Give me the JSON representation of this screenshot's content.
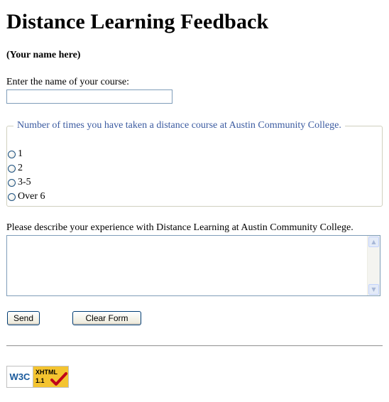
{
  "page": {
    "title": "Distance Learning Feedback",
    "subtitle": "(Your name here)"
  },
  "course": {
    "label": "Enter the name of your course:",
    "value": ""
  },
  "times": {
    "legend": "Number of times you have taken a distance course at Austin Community College.",
    "options": [
      "1",
      "2",
      "3-5",
      "Over 6"
    ]
  },
  "experience": {
    "label": "Please describe your experience with Distance Learning at Austin Community College."
  },
  "buttons": {
    "send": "Send",
    "clear": "Clear Form"
  },
  "badge": {
    "w3c": "W3C",
    "xhtml": "XHTML",
    "version": "1.1",
    "colors": {
      "gold": "#f4c430",
      "blue": "#1a5a9c",
      "check": "#c0001a"
    }
  }
}
